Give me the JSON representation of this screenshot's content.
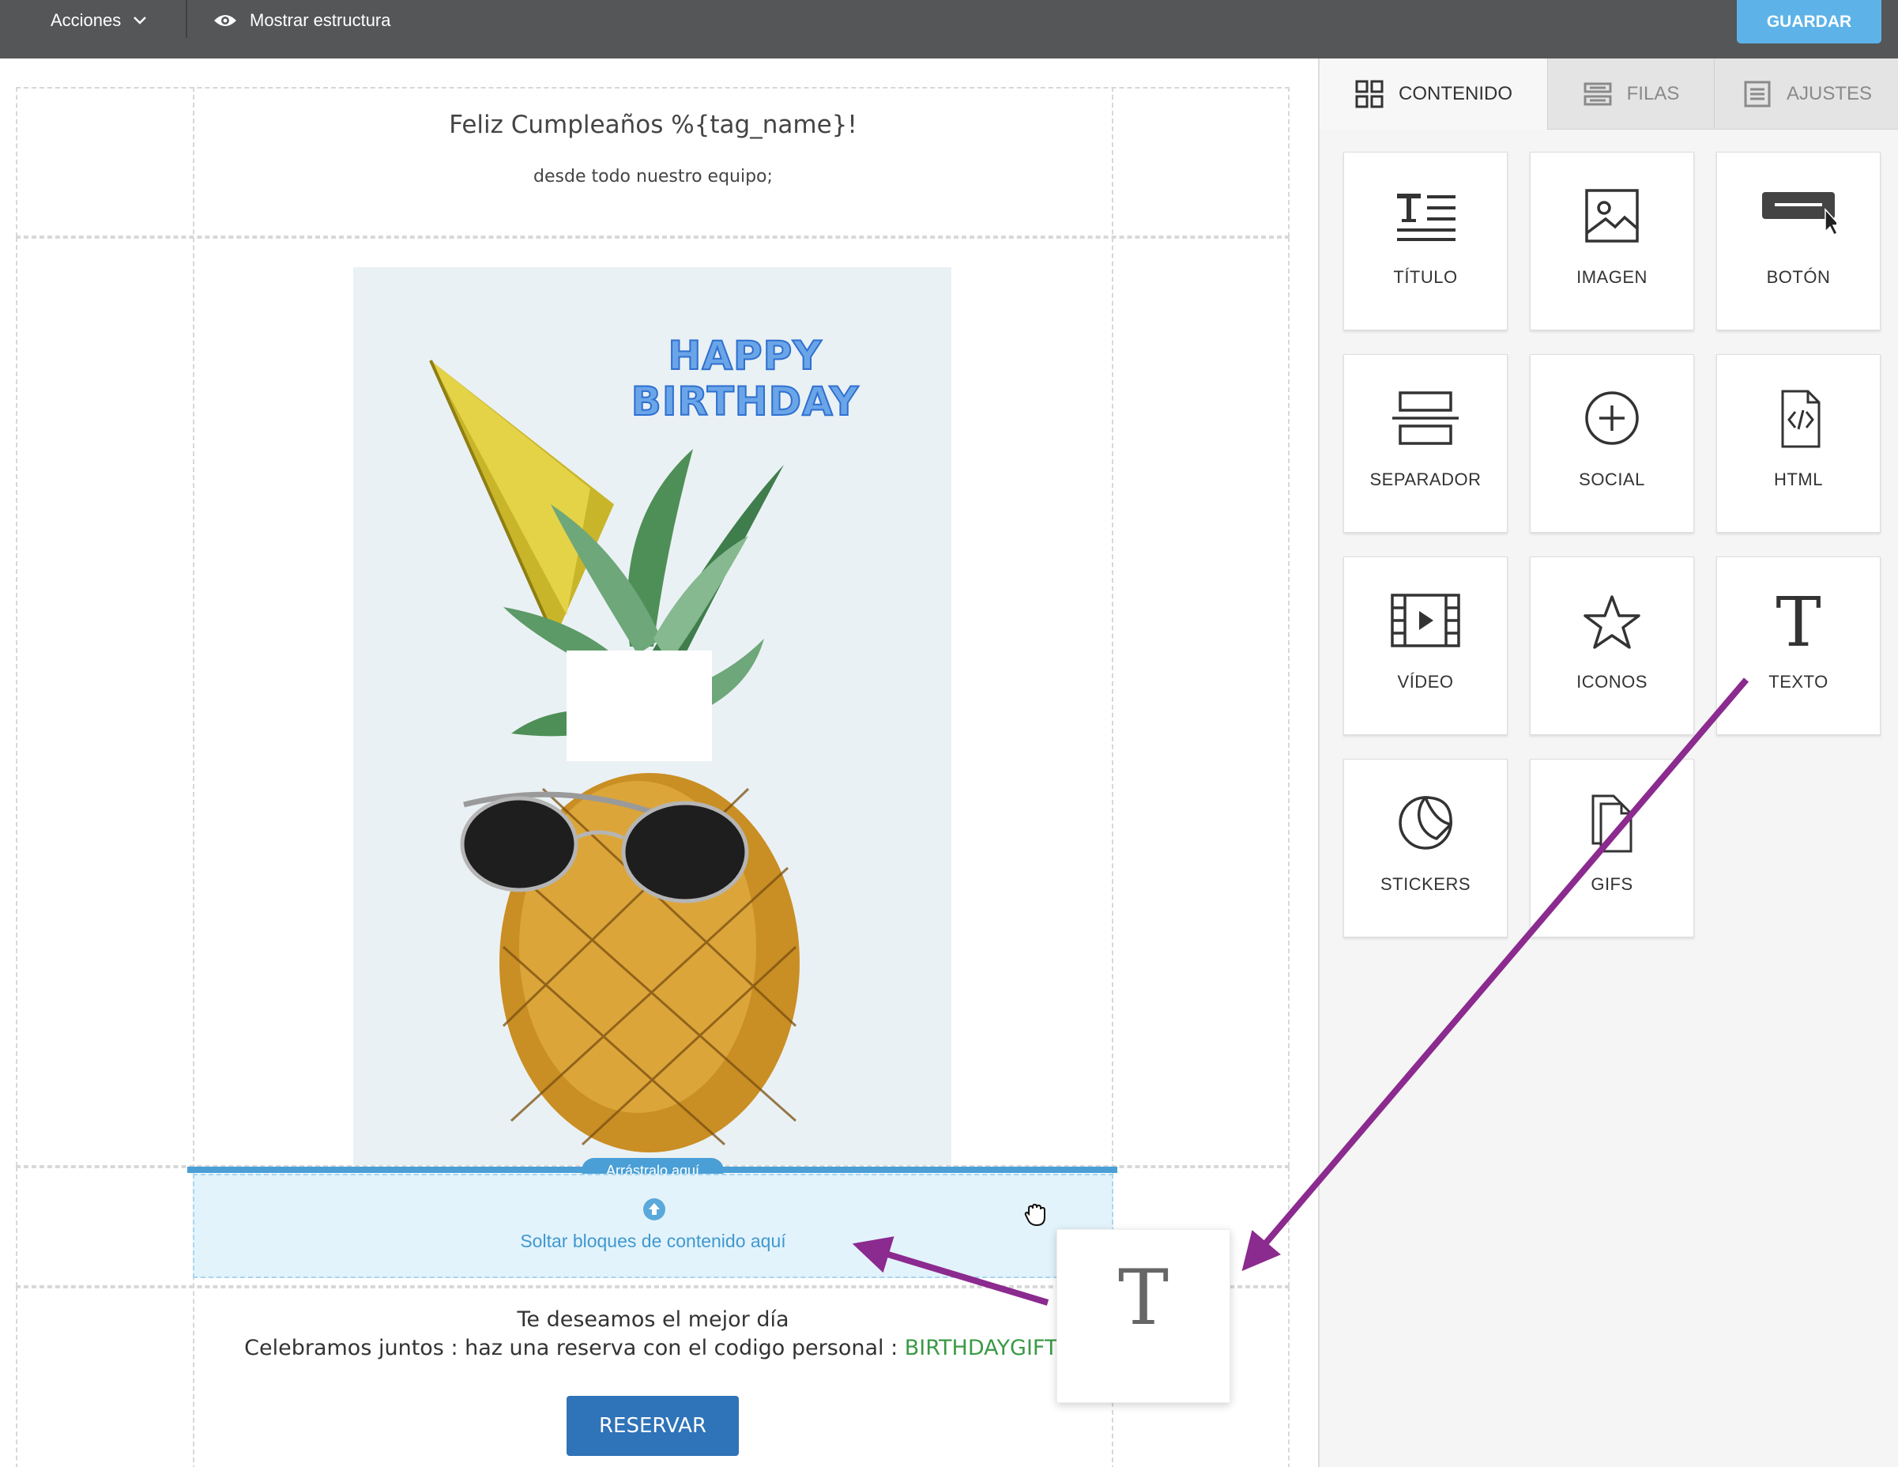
{
  "toolbar": {
    "actions_label": "Acciones",
    "structure_label": "Mostrar estructura",
    "save_label": "GUARDAR",
    "icons": [
      "chevron-down-icon",
      "eye-icon"
    ],
    "colors": {
      "bar": "#545658",
      "save": "#5db3e8"
    }
  },
  "email": {
    "title": "Feliz Cumpleaños %{tag_name}!",
    "subtitle": "desde todo nuestro equipo;",
    "hero_text": "HAPPY BIRTHDAY",
    "dropzone": {
      "pill": "Arrástralo aquí",
      "text": "Soltar bloques de contenido aquí"
    },
    "body_line1": "Te deseamos el mejor día",
    "body_line2_prefix": "Celebramos juntos : haz una reserva con el codigo personal : ",
    "gift_code": "BIRTHDAYGIFT.",
    "reserve_label": "RESERVAR",
    "colors": {
      "button": "#2f73b8",
      "code": "#3a9a46",
      "drop": "#4a9fd6"
    }
  },
  "sidebar": {
    "tabs": [
      {
        "label": "CONTENIDO",
        "icon": "grid-icon",
        "active": true
      },
      {
        "label": "FILAS",
        "icon": "rows-icon",
        "active": false
      },
      {
        "label": "AJUSTES",
        "icon": "settings-list-icon",
        "active": false
      }
    ],
    "blocks": [
      {
        "label": "TÍTULO",
        "icon": "title-icon"
      },
      {
        "label": "IMAGEN",
        "icon": "image-icon"
      },
      {
        "label": "BOTÓN",
        "icon": "button-icon"
      },
      {
        "label": "SEPARADOR",
        "icon": "divider-icon"
      },
      {
        "label": "SOCIAL",
        "icon": "plus-circle-icon"
      },
      {
        "label": "HTML",
        "icon": "code-file-icon"
      },
      {
        "label": "VÍDEO",
        "icon": "video-icon"
      },
      {
        "label": "ICONOS",
        "icon": "star-icon"
      },
      {
        "label": "TEXTO",
        "icon": "text-icon"
      },
      {
        "label": "STICKERS",
        "icon": "sticker-icon"
      },
      {
        "label": "GIFS",
        "icon": "gif-icon"
      }
    ]
  },
  "drag_ghost": {
    "glyph": "T"
  }
}
